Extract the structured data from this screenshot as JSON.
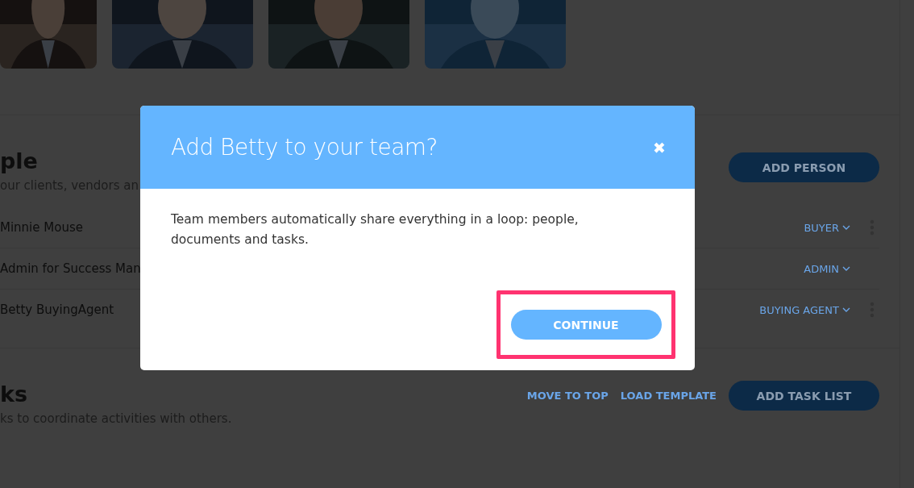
{
  "people": {
    "title": "ple",
    "subtitle": "our clients, vendors an",
    "add_button": "ADD PERSON",
    "rows": [
      {
        "name": "Minnie Mouse",
        "role": "BUYER",
        "menu": true
      },
      {
        "name": "Admin for Success Man",
        "role": "ADMIN",
        "menu": false
      },
      {
        "name": "Betty BuyingAgent",
        "role": "BUYING AGENT",
        "menu": true
      }
    ]
  },
  "tasks": {
    "title": "ks",
    "subtitle": "ks to coordinate activities with others.",
    "links": [
      "MOVE TO TOP",
      "LOAD TEMPLATE"
    ],
    "add_button": "ADD TASK LIST"
  },
  "dialog": {
    "title": "Add Betty to your team?",
    "close": "✖",
    "message": "Team members automatically share everything in a loop: people, documents and tasks.",
    "button": "CONTINUE",
    "highlighted": true
  }
}
